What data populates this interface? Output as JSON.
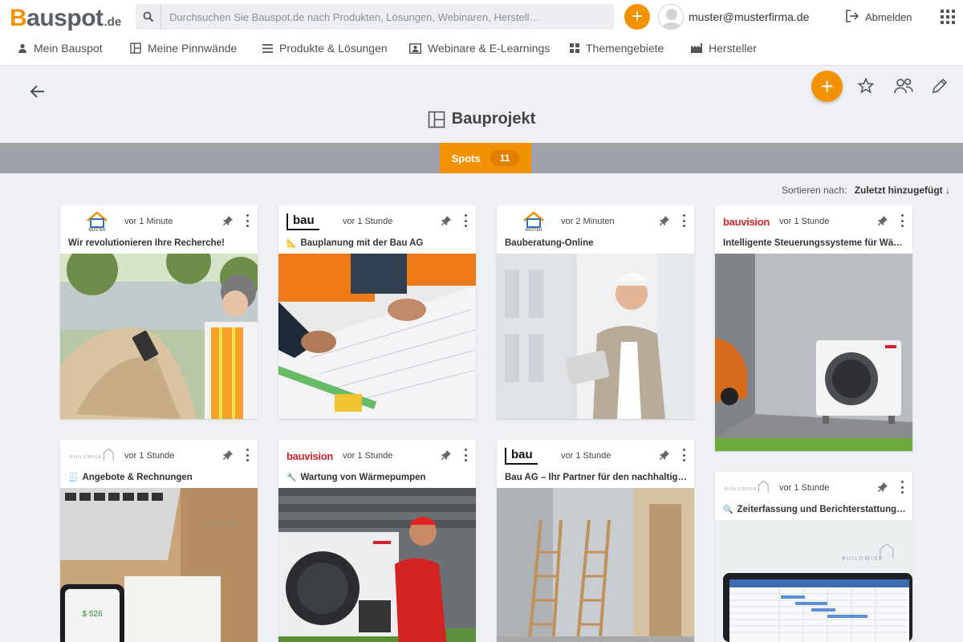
{
  "header": {
    "logo_main": "auspot",
    "logo_first": "B",
    "logo_tld": ".de",
    "search_placeholder": "Durchsuchen Sie Bauspot.de nach Produkten, Lösungen, Webinaren, Herstell…",
    "user_email": "muster@musterfirma.de",
    "logout_label": "Abmelden",
    "accent_color": "#f39200"
  },
  "nav": {
    "items": [
      {
        "label": "Mein Bauspot",
        "icon": "user-icon"
      },
      {
        "label": "Meine Pinnwände",
        "icon": "board-icon"
      },
      {
        "label": "Produkte & Lösungen",
        "icon": "list-icon"
      },
      {
        "label": "Webinare & E-Learnings",
        "icon": "webinar-icon"
      },
      {
        "label": "Themengebiete",
        "icon": "grid-icon"
      },
      {
        "label": "Hersteller",
        "icon": "factory-icon"
      }
    ]
  },
  "board": {
    "title": "Bauprojekt",
    "tab_label": "Spots",
    "tab_count": "11",
    "sort_label": "Sortieren nach:",
    "sort_value": "Zuletzt hinzugefügt ↓"
  },
  "cards": [
    {
      "brand": "MUSTER GMBH",
      "time": "vor 1 Minute",
      "title": "Wir revolutionieren Ihre Recherche!"
    },
    {
      "brand": "bau",
      "time": "vor 1 Stunde",
      "title": "Bauplanung mit der Bau AG",
      "emoji": "📐"
    },
    {
      "brand": "MUSTER GMBH",
      "time": "vor 2 Minuten",
      "title": "Bauberatung-Online"
    },
    {
      "brand": "bauvision",
      "time": "vor 1 Stunde",
      "title": "Intelligente Steuerungssysteme für Wärm…"
    },
    {
      "brand": "BUILDWISE",
      "time": "vor 1 Stunde",
      "title": "Angebote & Rechnungen",
      "emoji": "🧾"
    },
    {
      "brand": "bauvision",
      "time": "vor 1 Stunde",
      "title": "Wartung von Wärmepumpen",
      "emoji": "🔧"
    },
    {
      "brand": "bau",
      "time": "vor 1 Stunde",
      "title": "Bau AG – Ihr Partner für den nachhaltigen …"
    },
    {
      "brand": "BUILDWISE",
      "time": "vor 1 Stunde",
      "title": "Zeiterfassung und Berichterstattung le…",
      "emoji": "🔍"
    }
  ],
  "image_texts": {
    "phone_amount": "$ 526",
    "buildwise_watermark": "BUILDWISE"
  }
}
